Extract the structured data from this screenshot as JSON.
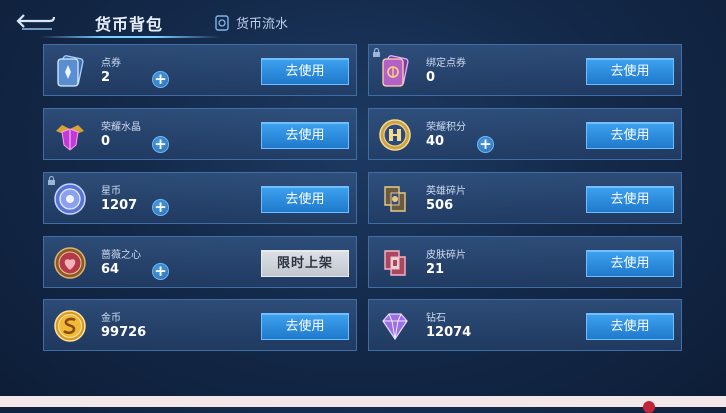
{
  "header": {
    "active_tab": "货币背包",
    "flow_tab": "货币流水"
  },
  "currencies": [
    {
      "name": "点券",
      "count": "2",
      "action": "去使用",
      "has_plus": true,
      "icon": "voucher-card-icon"
    },
    {
      "name": "绑定点券",
      "count": "0",
      "action": "去使用",
      "has_plus": false,
      "icon": "bound-voucher-card-icon"
    },
    {
      "name": "荣耀水晶",
      "count": "0",
      "action": "去使用",
      "has_plus": true,
      "icon": "glory-crystal-icon"
    },
    {
      "name": "荣耀积分",
      "count": "40",
      "action": "去使用",
      "has_plus": true,
      "icon": "glory-points-coin-icon"
    },
    {
      "name": "星币",
      "count": "1207",
      "action": "去使用",
      "has_plus": true,
      "icon": "star-coin-icon"
    },
    {
      "name": "英雄碎片",
      "count": "506",
      "action": "去使用",
      "has_plus": false,
      "icon": "hero-fragment-icon"
    },
    {
      "name": "蔷薇之心",
      "count": "64",
      "action": "限时上架",
      "has_plus": true,
      "icon": "rose-heart-icon"
    },
    {
      "name": "皮肤碎片",
      "count": "21",
      "action": "去使用",
      "has_plus": false,
      "icon": "skin-fragment-icon"
    },
    {
      "name": "金币",
      "count": "99726",
      "action": "去使用",
      "has_plus": false,
      "icon": "gold-coin-icon"
    },
    {
      "name": "钻石",
      "count": "12074",
      "action": "去使用",
      "has_plus": false,
      "icon": "diamond-icon"
    }
  ]
}
